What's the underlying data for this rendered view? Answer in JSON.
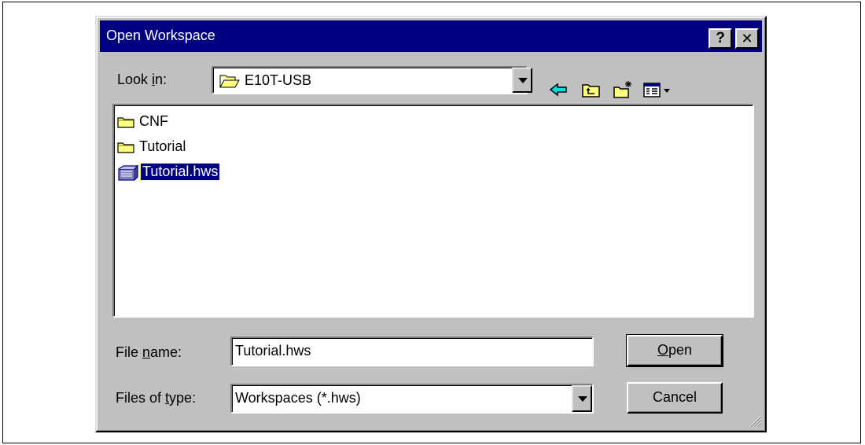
{
  "dialog": {
    "title": "Open Workspace",
    "help_button": "?",
    "close_button": "✕"
  },
  "look_in": {
    "label_pre": "Look ",
    "label_underlined": "i",
    "label_post": "n:",
    "value": "E10T-USB"
  },
  "files": [
    {
      "name": "CNF",
      "type": "folder"
    },
    {
      "name": "Tutorial",
      "type": "folder"
    },
    {
      "name": "Tutorial.hws",
      "type": "workspace",
      "selected": true
    }
  ],
  "file_name": {
    "label_pre": "File ",
    "label_underlined": "n",
    "label_post": "ame:",
    "value": "Tutorial.hws"
  },
  "file_type": {
    "label_pre": "Files of ",
    "label_underlined": "t",
    "label_post": "ype:",
    "value": "Workspaces (*.hws)"
  },
  "buttons": {
    "open_underlined": "O",
    "open_rest": "pen",
    "cancel": "Cancel"
  },
  "colors": {
    "titlebar": "#000080",
    "face": "#c0c0c0",
    "folder": "#ffff80"
  }
}
